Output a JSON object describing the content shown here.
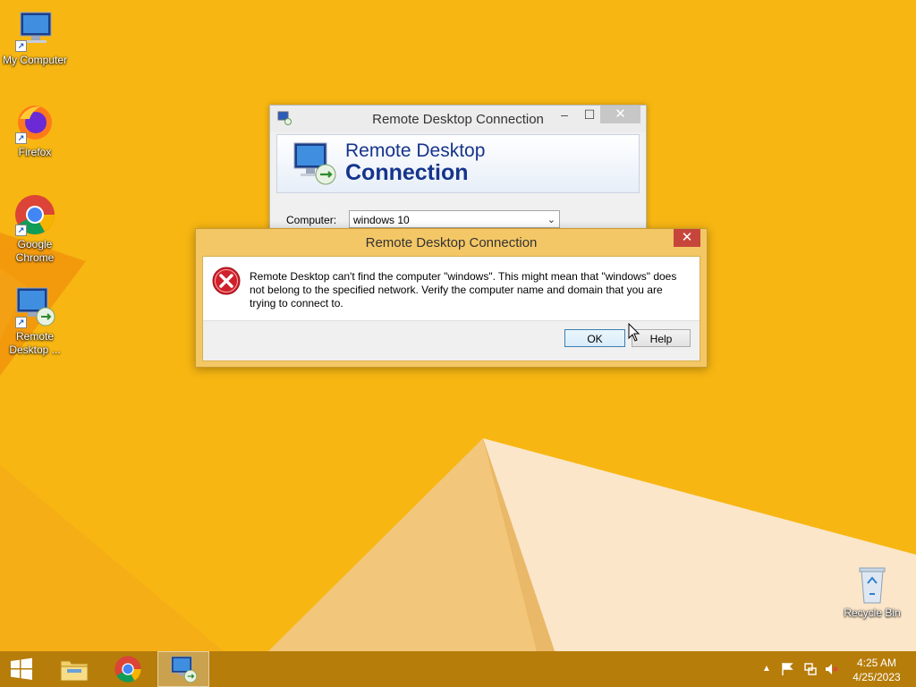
{
  "desktop": {
    "icons": [
      {
        "label": "My Computer",
        "icon": "computer-icon"
      },
      {
        "label": "Firefox",
        "icon": "firefox-icon"
      },
      {
        "label": "Google Chrome",
        "icon": "chrome-icon"
      },
      {
        "label": "Remote Desktop ...",
        "icon": "remote-desktop-icon"
      }
    ],
    "recycle_bin": {
      "label": "Recycle Bin",
      "icon": "recycle-bin-icon"
    }
  },
  "rdc_window": {
    "title": "Remote Desktop Connection",
    "banner_line1": "Remote Desktop",
    "banner_line2": "Connection",
    "computer_label": "Computer:",
    "computer_value": "windows 10",
    "controls": {
      "minimize": "–",
      "maximize": "☐",
      "close": "✕"
    }
  },
  "error_dialog": {
    "title": "Remote Desktop Connection",
    "close": "✕",
    "message": "Remote Desktop can't find the computer \"windows\". This might mean that \"windows\" does not belong to the specified network.  Verify the computer name and domain that you are trying to connect to.",
    "ok_label": "OK",
    "help_label": "Help"
  },
  "taskbar": {
    "items": [
      "start-icon",
      "file-explorer-icon",
      "chrome-icon",
      "remote-desktop-icon"
    ],
    "active_item": "remote-desktop-icon",
    "clock": {
      "time": "4:25 AM",
      "date": "4/25/2023"
    }
  },
  "colors": {
    "wallpaper": "#f6b20e",
    "accent_dark": "#15348c",
    "error_red": "#d0202b"
  }
}
